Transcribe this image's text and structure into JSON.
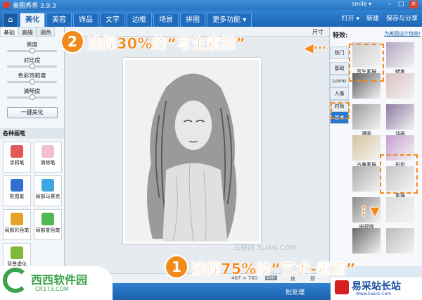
{
  "app": {
    "title": "美图秀秀 3.9.3",
    "user": "smile ▾"
  },
  "menu": {
    "home_icon": "home-icon",
    "tabs": [
      "美化",
      "美容",
      "饰品",
      "文字",
      "边框",
      "场景",
      "拼图",
      "更多功能 ▾"
    ],
    "active_tab": 0,
    "open": "打开 ▾",
    "new": "新建",
    "save_share": "保存与分享"
  },
  "left": {
    "subtabs": [
      "基础",
      "高级",
      "调色"
    ],
    "sliders": [
      {
        "label": "亮度",
        "value": 0.5
      },
      {
        "label": "对比度",
        "value": 0.5
      },
      {
        "label": "色彩饱和度",
        "value": 0.5
      },
      {
        "label": "清晰度",
        "value": 0.5
      }
    ],
    "onekey": "一键美化",
    "brush_title": "各种画笔",
    "tools": [
      {
        "label": "涂鸦笔",
        "color": "#e25757"
      },
      {
        "label": "消除笔",
        "color": "#f0c0d0"
      },
      {
        "label": "抠图笔",
        "color": "#2f6fd1"
      },
      {
        "label": "局部马赛克",
        "color": "#3fa7e0"
      },
      {
        "label": "局部彩色笔",
        "color": "#e6a22a"
      },
      {
        "label": "局部变色笔",
        "color": "#4fb84f"
      },
      {
        "label": "背景虚化",
        "color": "#7fb83b"
      }
    ]
  },
  "toolbar": {
    "size": "尺寸"
  },
  "right": {
    "effects_label": "特效:",
    "link": "为美图设计特效!",
    "categories": [
      "热门",
      "基础",
      "Lomo",
      "人像",
      "时尚",
      "艺术"
    ],
    "active_category": 5,
    "thumbs": [
      {
        "label": "写生素描",
        "color": "#c9c9c9"
      },
      {
        "label": "蜡笔",
        "color": "#b3a6c2"
      },
      {
        "label": "",
        "color": "#5f5f5f"
      },
      {
        "label": "",
        "color": "#d9c0c0"
      },
      {
        "label": "漫画",
        "color": "#9a9a9a"
      },
      {
        "label": "油画",
        "color": "#8c7aa0"
      },
      {
        "label": "古典素描",
        "color": "#d6c3a0"
      },
      {
        "label": "彩铅",
        "color": "#c59fd0"
      },
      {
        "label": "",
        "color": "#aaaaaa"
      },
      {
        "label": "素描",
        "color": "#c4c4c4"
      },
      {
        "label": "电视线",
        "color": "#8a8a8a"
      },
      {
        "label": "",
        "color": "#dcdcdc"
      },
      {
        "label": "",
        "color": "#6a6a6a"
      },
      {
        "label": "",
        "color": "#bbbbbb"
      }
    ]
  },
  "status": {
    "size": "467 × 700",
    "exif": "EXIF",
    "zoom": "放",
    "rotate": "预"
  },
  "bottom": {
    "batch": "批处理"
  },
  "annotations": {
    "step2_num": "2",
    "step2_text": "选择30%的“写生素描”",
    "step1_num": "1",
    "step1_text": "选择75%的“艺术-素描”"
  },
  "watermarks": {
    "left_name": "西西软件园",
    "left_url": "CR173.COM",
    "right_name": "易采站长站",
    "right_url": "Www.Easck.Com",
    "mid": "三联网 3LIAN.COM"
  },
  "colors": {
    "accent": "#f28a1b",
    "titlebar": "#2a74c0"
  }
}
